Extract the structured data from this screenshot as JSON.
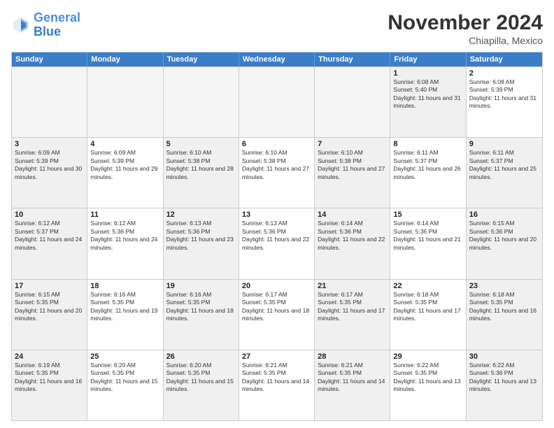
{
  "logo": {
    "line1": "General",
    "line2": "Blue"
  },
  "title": "November 2024",
  "location": "Chiapilla, Mexico",
  "header_days": [
    "Sunday",
    "Monday",
    "Tuesday",
    "Wednesday",
    "Thursday",
    "Friday",
    "Saturday"
  ],
  "rows": [
    [
      {
        "day": "",
        "info": "",
        "empty": true
      },
      {
        "day": "",
        "info": "",
        "empty": true
      },
      {
        "day": "",
        "info": "",
        "empty": true
      },
      {
        "day": "",
        "info": "",
        "empty": true
      },
      {
        "day": "",
        "info": "",
        "empty": true
      },
      {
        "day": "1",
        "info": "Sunrise: 6:08 AM\nSunset: 5:40 PM\nDaylight: 11 hours and 31 minutes.",
        "empty": false,
        "shaded": true
      },
      {
        "day": "2",
        "info": "Sunrise: 6:08 AM\nSunset: 5:39 PM\nDaylight: 11 hours and 31 minutes.",
        "empty": false,
        "shaded": false
      }
    ],
    [
      {
        "day": "3",
        "info": "Sunrise: 6:09 AM\nSunset: 5:39 PM\nDaylight: 11 hours and 30 minutes.",
        "empty": false,
        "shaded": true
      },
      {
        "day": "4",
        "info": "Sunrise: 6:09 AM\nSunset: 5:39 PM\nDaylight: 11 hours and 29 minutes.",
        "empty": false,
        "shaded": false
      },
      {
        "day": "5",
        "info": "Sunrise: 6:10 AM\nSunset: 5:38 PM\nDaylight: 11 hours and 28 minutes.",
        "empty": false,
        "shaded": true
      },
      {
        "day": "6",
        "info": "Sunrise: 6:10 AM\nSunset: 5:38 PM\nDaylight: 11 hours and 27 minutes.",
        "empty": false,
        "shaded": false
      },
      {
        "day": "7",
        "info": "Sunrise: 6:10 AM\nSunset: 5:38 PM\nDaylight: 11 hours and 27 minutes.",
        "empty": false,
        "shaded": true
      },
      {
        "day": "8",
        "info": "Sunrise: 6:11 AM\nSunset: 5:37 PM\nDaylight: 11 hours and 26 minutes.",
        "empty": false,
        "shaded": false
      },
      {
        "day": "9",
        "info": "Sunrise: 6:11 AM\nSunset: 5:37 PM\nDaylight: 11 hours and 25 minutes.",
        "empty": false,
        "shaded": true
      }
    ],
    [
      {
        "day": "10",
        "info": "Sunrise: 6:12 AM\nSunset: 5:37 PM\nDaylight: 11 hours and 24 minutes.",
        "empty": false,
        "shaded": true
      },
      {
        "day": "11",
        "info": "Sunrise: 6:12 AM\nSunset: 5:36 PM\nDaylight: 11 hours and 24 minutes.",
        "empty": false,
        "shaded": false
      },
      {
        "day": "12",
        "info": "Sunrise: 6:13 AM\nSunset: 5:36 PM\nDaylight: 11 hours and 23 minutes.",
        "empty": false,
        "shaded": true
      },
      {
        "day": "13",
        "info": "Sunrise: 6:13 AM\nSunset: 5:36 PM\nDaylight: 11 hours and 22 minutes.",
        "empty": false,
        "shaded": false
      },
      {
        "day": "14",
        "info": "Sunrise: 6:14 AM\nSunset: 5:36 PM\nDaylight: 11 hours and 22 minutes.",
        "empty": false,
        "shaded": true
      },
      {
        "day": "15",
        "info": "Sunrise: 6:14 AM\nSunset: 5:36 PM\nDaylight: 11 hours and 21 minutes.",
        "empty": false,
        "shaded": false
      },
      {
        "day": "16",
        "info": "Sunrise: 6:15 AM\nSunset: 5:36 PM\nDaylight: 11 hours and 20 minutes.",
        "empty": false,
        "shaded": true
      }
    ],
    [
      {
        "day": "17",
        "info": "Sunrise: 6:15 AM\nSunset: 5:35 PM\nDaylight: 11 hours and 20 minutes.",
        "empty": false,
        "shaded": true
      },
      {
        "day": "18",
        "info": "Sunrise: 6:16 AM\nSunset: 5:35 PM\nDaylight: 11 hours and 19 minutes.",
        "empty": false,
        "shaded": false
      },
      {
        "day": "19",
        "info": "Sunrise: 6:16 AM\nSunset: 5:35 PM\nDaylight: 11 hours and 18 minutes.",
        "empty": false,
        "shaded": true
      },
      {
        "day": "20",
        "info": "Sunrise: 6:17 AM\nSunset: 5:35 PM\nDaylight: 11 hours and 18 minutes.",
        "empty": false,
        "shaded": false
      },
      {
        "day": "21",
        "info": "Sunrise: 6:17 AM\nSunset: 5:35 PM\nDaylight: 11 hours and 17 minutes.",
        "empty": false,
        "shaded": true
      },
      {
        "day": "22",
        "info": "Sunrise: 6:18 AM\nSunset: 5:35 PM\nDaylight: 11 hours and 17 minutes.",
        "empty": false,
        "shaded": false
      },
      {
        "day": "23",
        "info": "Sunrise: 6:18 AM\nSunset: 5:35 PM\nDaylight: 11 hours and 16 minutes.",
        "empty": false,
        "shaded": true
      }
    ],
    [
      {
        "day": "24",
        "info": "Sunrise: 6:19 AM\nSunset: 5:35 PM\nDaylight: 11 hours and 16 minutes.",
        "empty": false,
        "shaded": true
      },
      {
        "day": "25",
        "info": "Sunrise: 6:20 AM\nSunset: 5:35 PM\nDaylight: 11 hours and 15 minutes.",
        "empty": false,
        "shaded": false
      },
      {
        "day": "26",
        "info": "Sunrise: 6:20 AM\nSunset: 5:35 PM\nDaylight: 11 hours and 15 minutes.",
        "empty": false,
        "shaded": true
      },
      {
        "day": "27",
        "info": "Sunrise: 6:21 AM\nSunset: 5:35 PM\nDaylight: 11 hours and 14 minutes.",
        "empty": false,
        "shaded": false
      },
      {
        "day": "28",
        "info": "Sunrise: 6:21 AM\nSunset: 5:35 PM\nDaylight: 11 hours and 14 minutes.",
        "empty": false,
        "shaded": true
      },
      {
        "day": "29",
        "info": "Sunrise: 6:22 AM\nSunset: 5:35 PM\nDaylight: 11 hours and 13 minutes.",
        "empty": false,
        "shaded": false
      },
      {
        "day": "30",
        "info": "Sunrise: 6:22 AM\nSunset: 5:36 PM\nDaylight: 11 hours and 13 minutes.",
        "empty": false,
        "shaded": true
      }
    ]
  ]
}
